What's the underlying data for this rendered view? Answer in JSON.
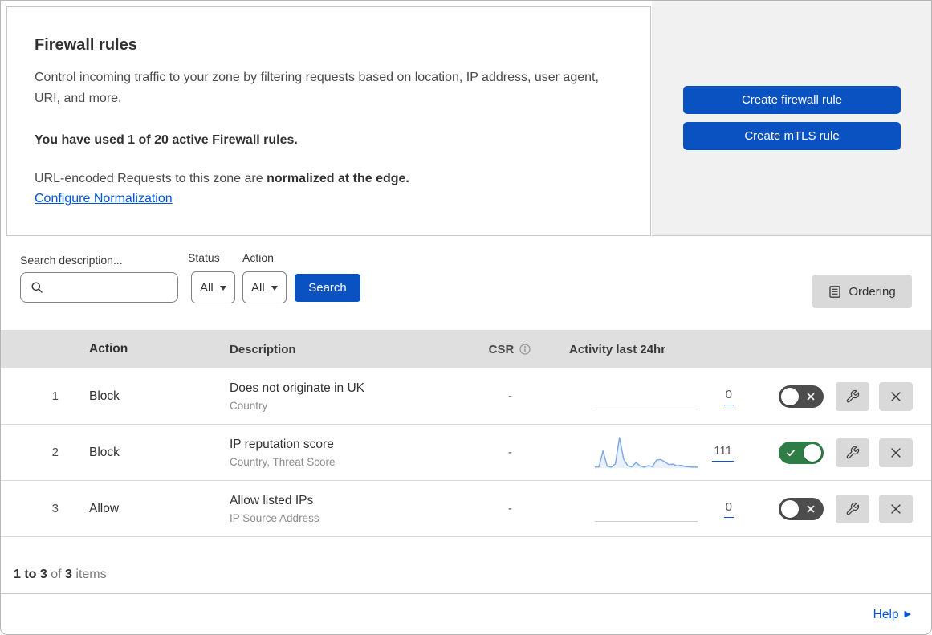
{
  "header": {
    "title": "Firewall rules",
    "description": "Control incoming traffic to your zone by filtering requests based on location, IP address, user agent, URI, and more.",
    "usage": "You have used 1 of 20 active Firewall rules.",
    "normalization_prefix": "URL-encoded Requests to this zone are ",
    "normalization_bold": "normalized at the edge.",
    "normalization_link": "Configure Normalization",
    "buttons": {
      "create_firewall": "Create firewall rule",
      "create_mtls": "Create mTLS rule"
    }
  },
  "filters": {
    "search_label": "Search description...",
    "status_label": "Status",
    "status_value": "All",
    "action_label": "Action",
    "action_value": "All",
    "search_button": "Search",
    "ordering_button": "Ordering"
  },
  "table": {
    "columns": {
      "action": "Action",
      "description": "Description",
      "csr": "CSR",
      "activity": "Activity last 24hr"
    },
    "rows": [
      {
        "index": "1",
        "action": "Block",
        "description": "Does not originate in UK",
        "criteria": "Country",
        "csr": "-",
        "activity_count": "0",
        "enabled": false,
        "sparkline": null
      },
      {
        "index": "2",
        "action": "Block",
        "description": "IP reputation score",
        "criteria": "Country, Threat Score",
        "csr": "-",
        "activity_count": "111",
        "enabled": true,
        "sparkline": [
          3,
          4,
          56,
          6,
          3,
          14,
          100,
          30,
          7,
          4,
          18,
          7,
          3,
          8,
          5,
          26,
          28,
          21,
          11,
          13,
          7,
          9,
          5,
          4,
          3,
          3
        ]
      },
      {
        "index": "3",
        "action": "Allow",
        "description": "Allow listed IPs",
        "criteria": "IP Source Address",
        "csr": "-",
        "activity_count": "0",
        "enabled": false,
        "sparkline": null
      }
    ],
    "summary": {
      "range": "1 to 3",
      "of": "of",
      "total": "3",
      "items": "items"
    }
  },
  "footer": {
    "help": "Help",
    "help_arrow": "▶"
  },
  "colors": {
    "accent_blue": "#0a52c2",
    "link_blue": "#0055dc",
    "toggle_on_green": "#2e7d46",
    "toggle_off_gray": "#4d4d4d",
    "sparkline_blue": "#7fa9e6"
  }
}
